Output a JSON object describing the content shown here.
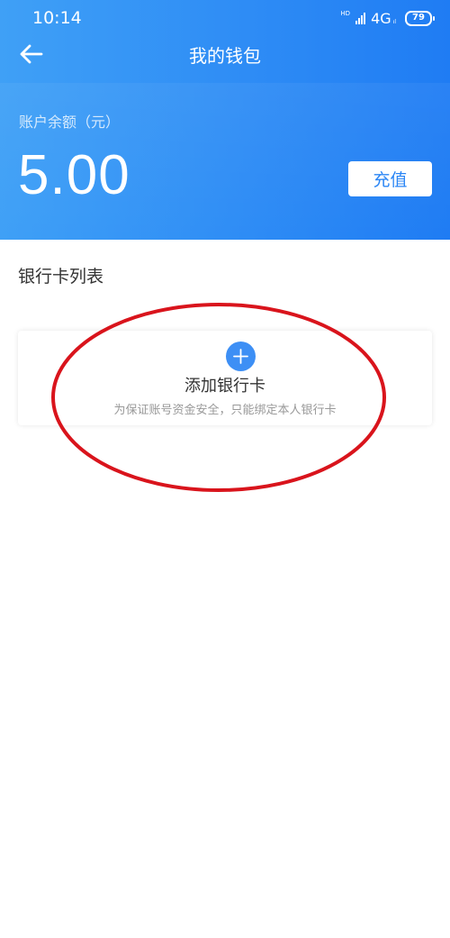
{
  "status_bar": {
    "time": "10:14",
    "hd_label": "HD",
    "network": "4G",
    "network_sub": "ıl",
    "battery": "79"
  },
  "nav": {
    "back_icon": "arrow-left-icon",
    "title": "我的钱包"
  },
  "wallet": {
    "balance_label": "账户余额（元）",
    "balance_value": "5.00",
    "recharge_label": "充值"
  },
  "bank_cards": {
    "section_title": "银行卡列表",
    "add_icon": "plus-circle-icon",
    "add_title": "添加银行卡",
    "add_subtitle": "为保证账号资金安全，只能绑定本人银行卡"
  },
  "colors": {
    "header_start": "#3fa0f6",
    "header_end": "#1f7cf3",
    "accent": "#2b86f5",
    "annotation_red": "#d9141c"
  }
}
